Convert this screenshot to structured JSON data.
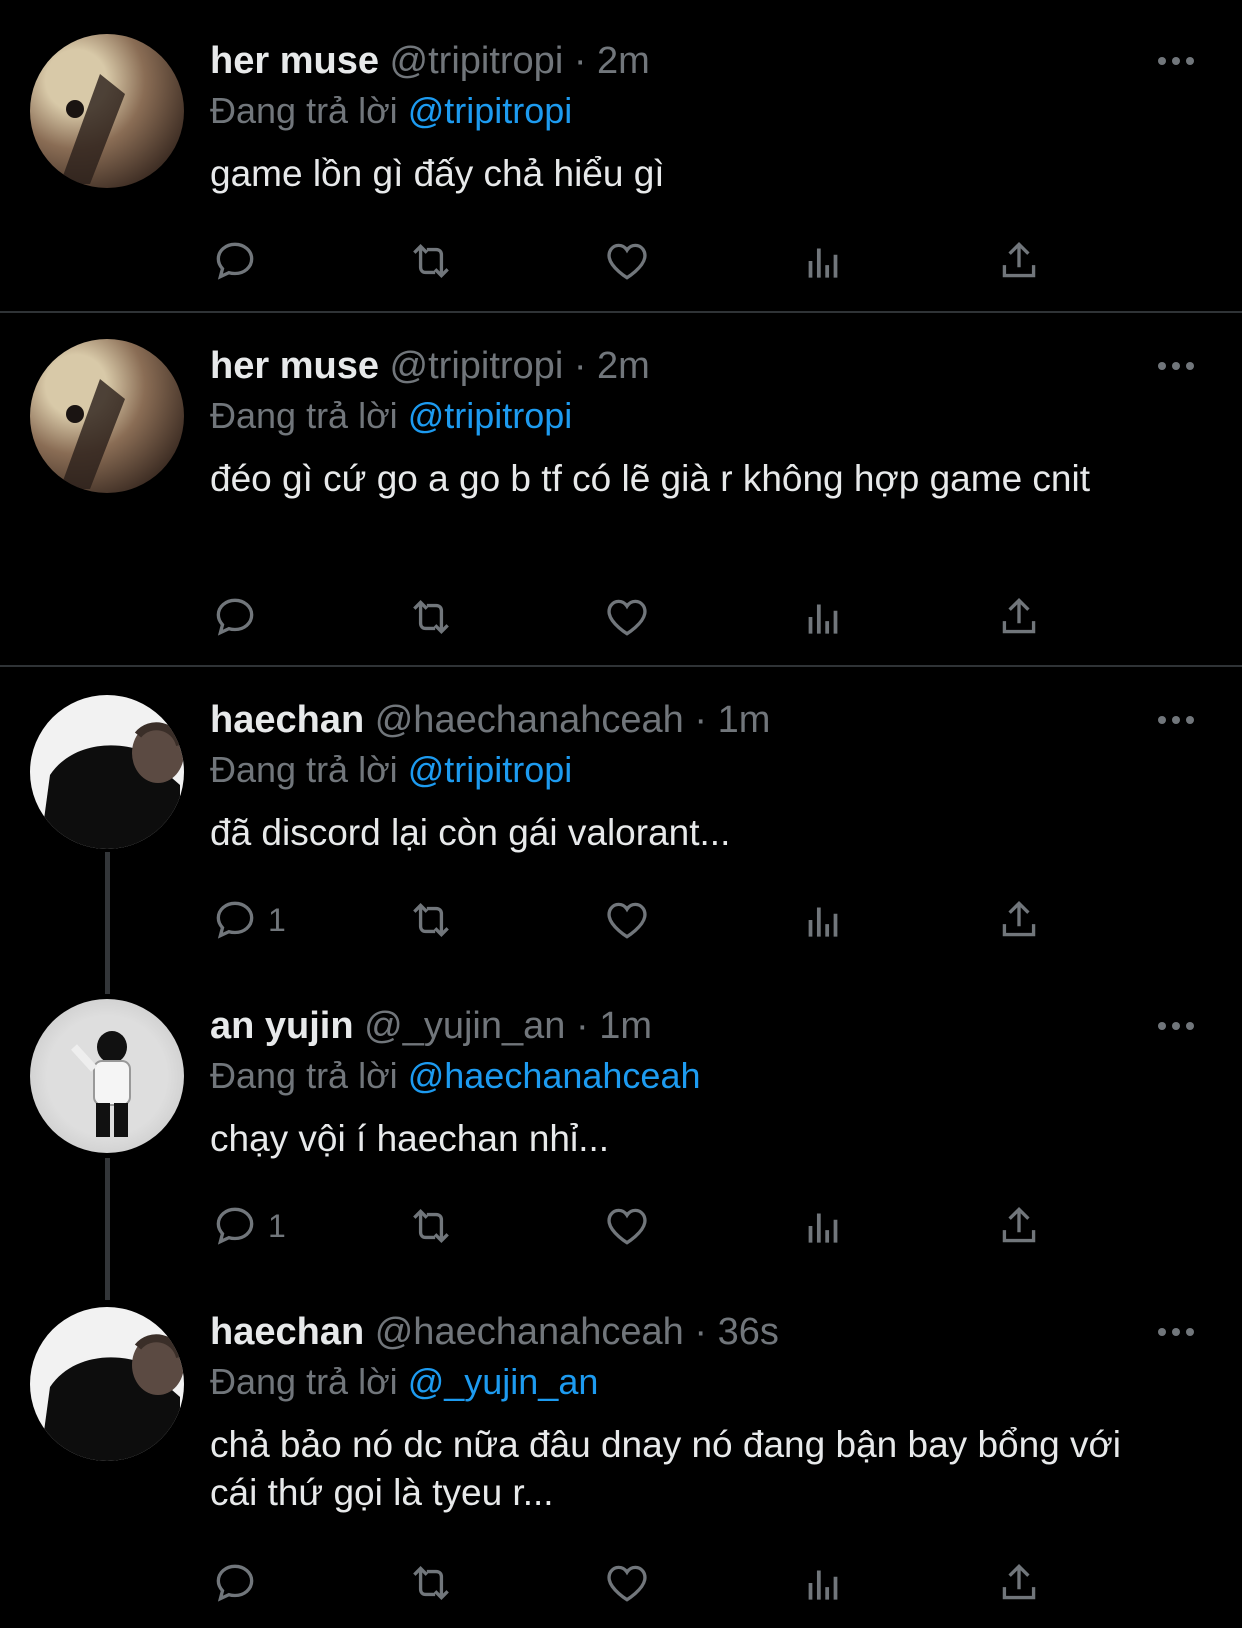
{
  "reply_prefix": "Đang trả lời",
  "tweets": [
    {
      "name": "her muse",
      "handle": "@tripitropi",
      "dot": "·",
      "time": "2m",
      "reply_to": "@tripitropi",
      "text": "game lồn gì đấy chả hiểu gì",
      "reply_count": "",
      "avatar": "muse"
    },
    {
      "name": "her muse",
      "handle": "@tripitropi",
      "dot": "·",
      "time": "2m",
      "reply_to": "@tripitropi",
      "text": "đéo gì cứ go a go b tf có lẽ già r không hợp game cnit",
      "reply_count": "",
      "avatar": "muse"
    },
    {
      "name": "haechan",
      "handle": "@haechanahceah",
      "dot": "·",
      "time": "1m",
      "reply_to": "@tripitropi",
      "text": "đã discord lại còn gái valorant...",
      "reply_count": "1",
      "avatar": "haechan"
    },
    {
      "name": "an yujin",
      "handle": "@_yujin_an",
      "dot": "·",
      "time": "1m",
      "reply_to": "@haechanahceah",
      "text": "chạy vội í haechan nhỉ...",
      "reply_count": "1",
      "avatar": "yujin"
    },
    {
      "name": "haechan",
      "handle": "@haechanahceah",
      "dot": "·",
      "time": "36s",
      "reply_to": "@_yujin_an",
      "text": "chả bảo nó dc nữa đâu dnay nó đang bận bay bổng với cái thứ gọi là tyeu r...",
      "reply_count": "",
      "avatar": "haechan"
    }
  ],
  "icons": {
    "reply": "reply-icon",
    "retweet": "retweet-icon",
    "like": "heart-icon",
    "views": "views-icon",
    "share": "share-icon",
    "more": "more-icon"
  },
  "colors": {
    "background": "#000000",
    "text": "#e7e9ea",
    "muted": "#71767b",
    "link": "#1d9bf0",
    "separator": "#2f3336"
  }
}
